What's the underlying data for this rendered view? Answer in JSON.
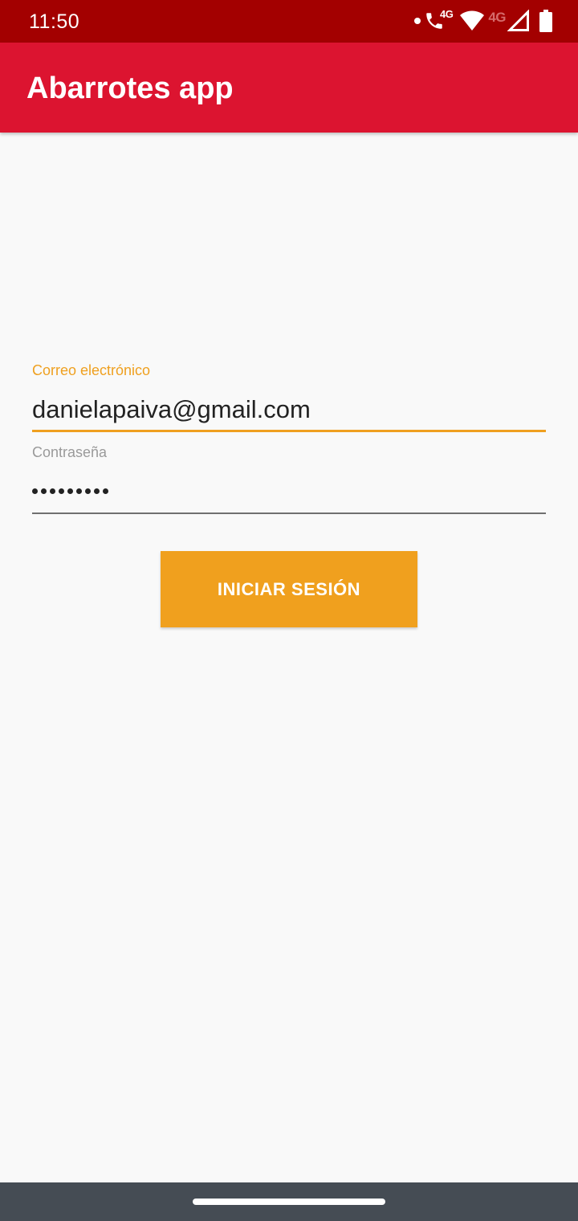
{
  "status_bar": {
    "time": "11:50",
    "icons": [
      "notification-dot-icon",
      "volte-call-icon",
      "wifi-icon",
      "mobile-signal-icon",
      "battery-icon"
    ],
    "call_network_label": "4G",
    "mobile_network_label": "4G",
    "background_color": "#a30000"
  },
  "app_bar": {
    "title": "Abarrotes app",
    "background_color": "#dc1430"
  },
  "login_form": {
    "email": {
      "label": "Correo electrónico",
      "value": "danielapaiva@gmail.com",
      "focused": true,
      "accent_color": "#efa020"
    },
    "password": {
      "label": "Contraseña",
      "masked_length": 9
    },
    "submit_label": "INICIAR SESIÓN",
    "button_color": "#f0a01e"
  },
  "nav_bar": {
    "background_color": "#454c54"
  }
}
